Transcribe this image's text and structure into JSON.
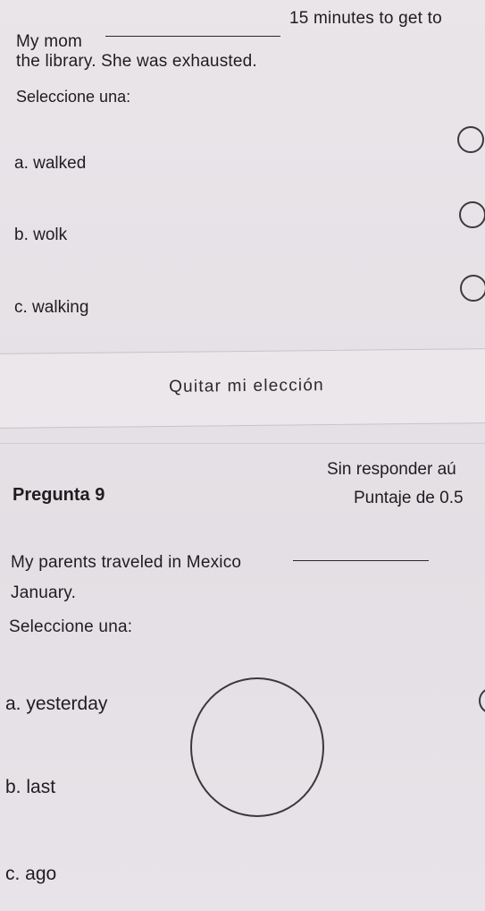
{
  "question8": {
    "text_start": "My mom",
    "text_after_blank": "15 minutes to get to",
    "text_line2": "the library. She was exhausted.",
    "prompt": "Seleccione una:",
    "options": [
      {
        "label": "a. walked",
        "selected": false
      },
      {
        "label": "b. wolk",
        "selected": false
      },
      {
        "label": "c. walking",
        "selected": false
      }
    ],
    "clear_choice_label": "Quitar mi elección"
  },
  "question9": {
    "title": "Pregunta 9",
    "status": "Sin responder aú",
    "score": "Puntaje de 0.5",
    "text_start": "My parents traveled in Mexico",
    "text_line2": "January.",
    "prompt": "Seleccione una:",
    "options": [
      {
        "label": "a. yesterday",
        "selected": false
      },
      {
        "label": "b. last",
        "selected": false
      },
      {
        "label": "c. ago",
        "selected": false
      }
    ]
  },
  "colors": {
    "background": "#e7e2e6",
    "text": "#1f1d21",
    "radio_border": "#3c3a3f"
  }
}
